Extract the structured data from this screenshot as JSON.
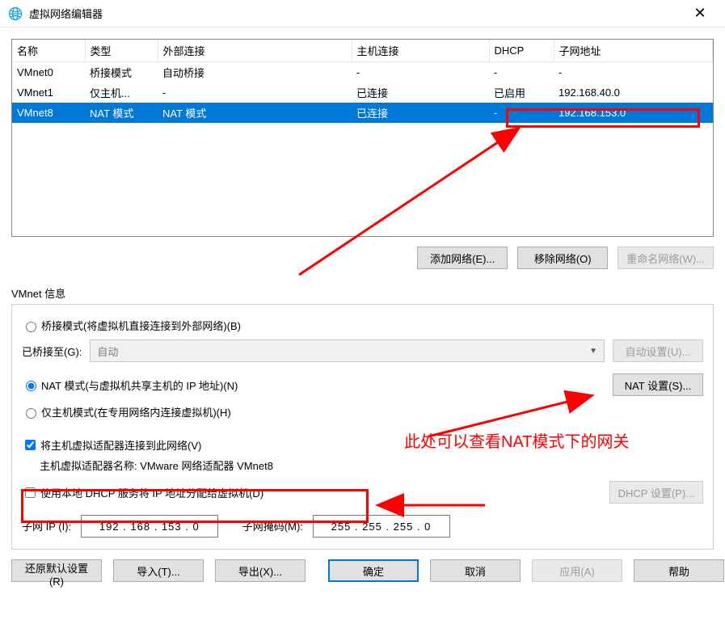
{
  "window": {
    "title": "虚拟网络编辑器"
  },
  "table": {
    "headers": {
      "name": "名称",
      "type": "类型",
      "ext": "外部连接",
      "host": "主机连接",
      "dhcp": "DHCP",
      "subnet": "子网地址"
    },
    "rows": [
      {
        "name": "VMnet0",
        "type": "桥接模式",
        "ext": "自动桥接",
        "host": "-",
        "dhcp": "-",
        "subnet": "-",
        "selected": false
      },
      {
        "name": "VMnet1",
        "type": "仅主机...",
        "ext": "-",
        "host": "已连接",
        "dhcp": "已启用",
        "subnet": "192.168.40.0",
        "selected": false
      },
      {
        "name": "VMnet8",
        "type": "NAT 模式",
        "ext": "NAT 模式",
        "host": "已连接",
        "dhcp": "-",
        "subnet": "192.168.153.0",
        "selected": true
      }
    ]
  },
  "buttons": {
    "add_net": "添加网络(E)...",
    "remove_net": "移除网络(O)",
    "rename_net": "重命名网络(W)...",
    "auto_set": "自动设置(U)...",
    "nat_set": "NAT 设置(S)...",
    "dhcp_set": "DHCP 设置(P)...",
    "restore": "还原默认设置(R)",
    "import": "导入(T)...",
    "export": "导出(X)...",
    "ok": "确定",
    "cancel": "取消",
    "apply": "应用(A)",
    "help": "帮助"
  },
  "vmnet_info": {
    "header": "VMnet 信息",
    "bridge_radio": "桥接模式(将虚拟机直接连接到外部网络)(B)",
    "bridge_to_label": "已桥接至(G):",
    "bridge_to_value": "自动",
    "nat_radio": "NAT 模式(与虚拟机共享主机的 IP 地址)(N)",
    "hostonly_radio": "仅主机模式(在专用网络内连接虚拟机)(H)",
    "host_adapter_check": "将主机虚拟适配器连接到此网络(V)",
    "host_adapter_name_label": "主机虚拟适配器名称: VMware 网络适配器 VMnet8",
    "dhcp_check": "使用本地 DHCP 服务将 IP 地址分配给虚拟机(D)",
    "subnet_ip_label": "子网 IP (I):",
    "subnet_ip_value": "192 . 168 . 153 .   0",
    "subnet_mask_label": "子网掩码(M):",
    "subnet_mask_value": "255 . 255 . 255 .   0"
  },
  "annotation": {
    "text": "此处可以查看NAT模式下的网关"
  }
}
